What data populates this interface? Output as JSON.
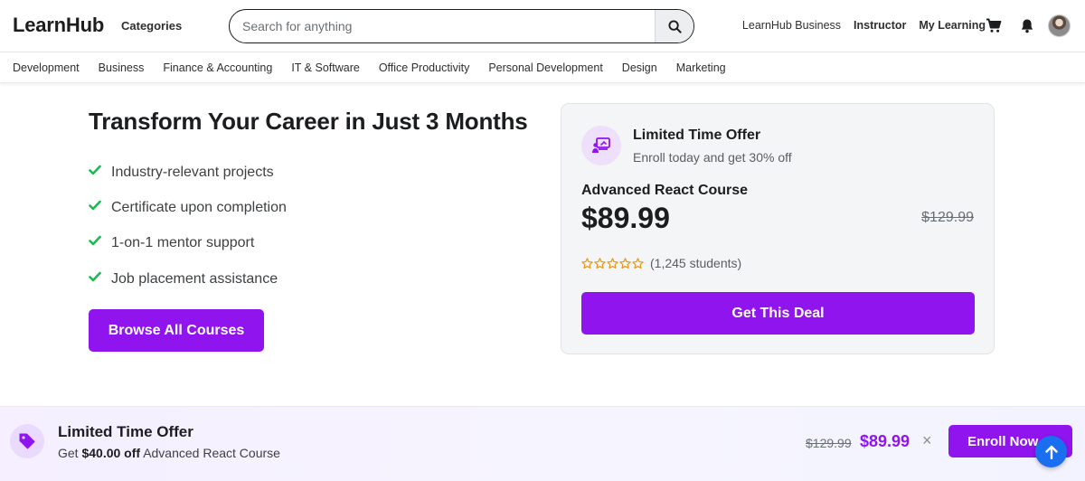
{
  "header": {
    "logo": "LearnHub",
    "categories_label": "Categories",
    "search_placeholder": "Search for anything",
    "nav": {
      "business": "LearnHub Business",
      "instructor": "Instructor",
      "my_learning": "My Learning"
    },
    "icons": [
      "search-icon",
      "cart-icon",
      "bell-icon",
      "avatar"
    ]
  },
  "category_bar": [
    "Development",
    "Business",
    "Finance & Accounting",
    "IT & Software",
    "Office Productivity",
    "Personal Development",
    "Design",
    "Marketing"
  ],
  "hero": {
    "headline": "Transform Your Career in Just 3 Months",
    "features": [
      "Industry-relevant projects",
      "Certificate upon completion",
      "1-on-1 mentor support",
      "Job placement assistance"
    ],
    "browse_button": "Browse All Courses"
  },
  "offer_card": {
    "title": "Limited Time Offer",
    "subtitle": "Enroll today and get 30% off",
    "course_name": "Advanced React Course",
    "price": "$89.99",
    "old_price": "$129.99",
    "rating_stars": 0,
    "rating_max": 5,
    "students": "(1,245 students)",
    "cta": "Get This Deal"
  },
  "banner": {
    "title": "Limited Time Offer",
    "sub_prefix": "Get",
    "sub_amount": "$40.00 off",
    "sub_course": "Advanced React Course",
    "old_price": "$129.99",
    "new_price": "$89.99",
    "close": "×",
    "cta": "Enroll Now"
  },
  "colors": {
    "accent": "#8f14ee",
    "check": "#1eb954",
    "star": "#e59819",
    "scroll_button": "#1a6ff0"
  }
}
